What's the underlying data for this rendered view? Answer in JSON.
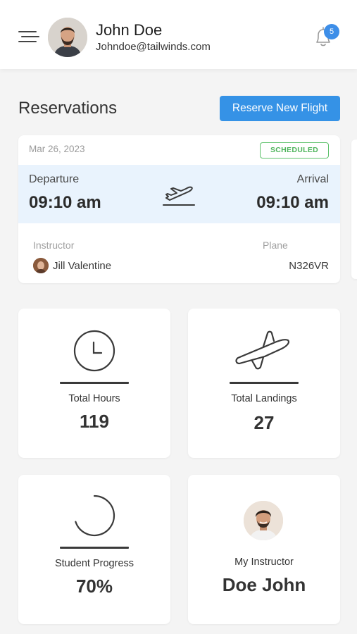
{
  "header": {
    "user_name": "John Doe",
    "user_email": "Johndoe@tailwinds.com",
    "notification_count": "5"
  },
  "reservations": {
    "title": "Reservations",
    "reserve_button_label": "Reserve New Flight",
    "card": {
      "date": "Mar 26, 2023",
      "status": "SCHEDULED",
      "departure_label": "Departure",
      "departure_time": "09:10 am",
      "arrival_label": "Arrival",
      "arrival_time": "09:10 am",
      "instructor_label": "Instructor",
      "instructor_name": "Jill Valentine",
      "plane_label": "Plane",
      "plane_value": "N326VR"
    }
  },
  "stats": {
    "total_hours_label": "Total Hours",
    "total_hours_value": "119",
    "total_landings_label": "Total Landings",
    "total_landings_value": "27",
    "student_progress_label": "Student Progress",
    "student_progress_value": "70%",
    "student_progress_fraction": 0.7,
    "my_instructor_label": "My Instructor",
    "my_instructor_name": "Doe John"
  },
  "colors": {
    "accent": "#3592e6",
    "scheduled_green": "#4cb35a",
    "flight_band": "#e9f3fd"
  }
}
